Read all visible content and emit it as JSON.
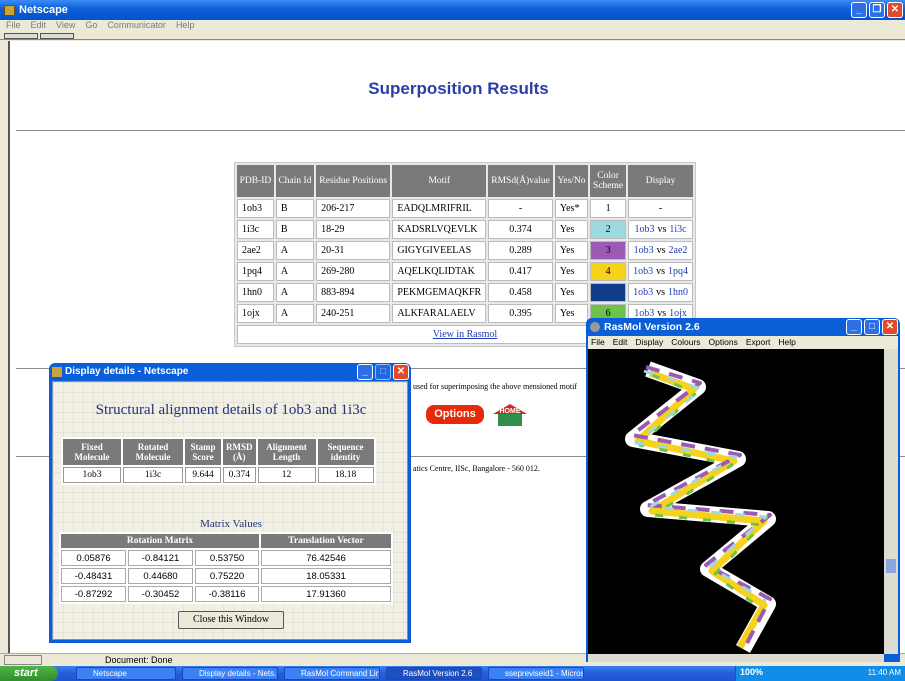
{
  "browser": {
    "title": "Netscape",
    "menu": [
      "File",
      "Edit",
      "View",
      "Go",
      "Communicator",
      "Help"
    ],
    "status": "Document: Done"
  },
  "page": {
    "title": "Superposition Results",
    "results_table": {
      "headers": [
        "PDB-ID",
        "Chain Id",
        "Residue Positions",
        "Motif",
        "RMSd(Å)value",
        "Yes/No",
        "Color Scheme",
        "Display"
      ],
      "rows": [
        {
          "pdb": "1ob3",
          "chain": "B",
          "residues": "206-217",
          "motif": "EADQLMRIFRIL",
          "rmsd": "-",
          "yes": "Yes*",
          "scheme": "1",
          "color": "#ffffff",
          "display_a": "",
          "display_vs": "",
          "display_b": "",
          "display_text": "-"
        },
        {
          "pdb": "1i3c",
          "chain": "B",
          "residues": "18-29",
          "motif": "KADSRLVQEVLK",
          "rmsd": "0.374",
          "yes": "Yes",
          "scheme": "2",
          "color": "#9ed8e0",
          "display_a": "1ob3",
          "display_vs": "vs",
          "display_b": "1i3c"
        },
        {
          "pdb": "2ae2",
          "chain": "A",
          "residues": "20-31",
          "motif": "GIGYGIVEELAS",
          "rmsd": "0.289",
          "yes": "Yes",
          "scheme": "3",
          "color": "#9b5bb5",
          "display_a": "1ob3",
          "display_vs": "vs",
          "display_b": "2ae2"
        },
        {
          "pdb": "1pq4",
          "chain": "A",
          "residues": "269-280",
          "motif": "AQELKQLIDTAK",
          "rmsd": "0.417",
          "yes": "Yes",
          "scheme": "4",
          "color": "#f6d21a",
          "display_a": "1ob3",
          "display_vs": "vs",
          "display_b": "1pq4"
        },
        {
          "pdb": "1hn0",
          "chain": "A",
          "residues": "883-894",
          "motif": "PEKMGEMAQKFR",
          "rmsd": "0.458",
          "yes": "Yes",
          "scheme": "5",
          "color": "#0f3d8c",
          "display_a": "1ob3",
          "display_vs": "vs",
          "display_b": "1hn0"
        },
        {
          "pdb": "1ojx",
          "chain": "A",
          "residues": "240-251",
          "motif": "ALKFARALAELV",
          "rmsd": "0.395",
          "yes": "Yes",
          "scheme": "6",
          "color": "#6cc24a",
          "display_a": "1ob3",
          "display_vs": "vs",
          "display_b": "1ojx"
        }
      ],
      "view_link": "View in Rasmol"
    },
    "partial_texts": {
      "used_for": "used for superimposing the above mensioned motif",
      "footer": "atics Centre, IISc, Bangalore - 560 012."
    },
    "options_label": "Options",
    "home_label": "HOME"
  },
  "details_window": {
    "title": "Display details - Netscape",
    "heading": "Structural alignment details of 1ob3 and 1i3c",
    "align_headers": [
      "Fixed Molecule",
      "Rotated Molecule",
      "Stamp Score",
      "RMSD (Å)",
      "Alignment Length",
      "Sequence identity"
    ],
    "align_values": [
      "1ob3",
      "1i3c",
      "9.644",
      "0.374",
      "12",
      "18.18"
    ],
    "matrix_title": "Matrix Values",
    "matrix_headers": [
      "Rotation Matrix",
      "Translation Vector"
    ],
    "matrix_rows": [
      [
        "0.05876",
        "-0.84121",
        "0.53750",
        "76.42546"
      ],
      [
        "-0.48431",
        "0.44680",
        "0.75220",
        "18.05331"
      ],
      [
        "-0.87292",
        "-0.30452",
        "-0.38116",
        "17.91360"
      ]
    ],
    "close_label": "Close this Window"
  },
  "rasmol": {
    "title": "RasMol Version 2.6",
    "menu": [
      "File",
      "Edit",
      "Display",
      "Colours",
      "Options",
      "Export",
      "Help"
    ]
  },
  "taskbar": {
    "start": "start",
    "tasks": [
      "Netscape",
      "Display details - Nets...",
      "RasMol Command Line",
      "RasMol Version 2.6",
      "ssepreviseid1 - Micros..."
    ],
    "battery": "100%",
    "time": "11:40 AM"
  }
}
